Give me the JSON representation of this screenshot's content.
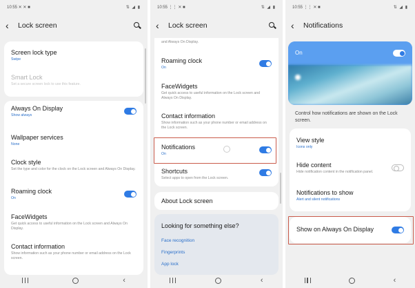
{
  "screen1": {
    "status_time": "10:55 ✕ ✕ ■",
    "status_icons": "⇅ ◢ ▮",
    "title": "Lock screen",
    "rows": {
      "screen_lock_type": {
        "label": "Screen lock type",
        "sub": "Swipe"
      },
      "smart_lock": {
        "label": "Smart Lock",
        "desc": "Set a secure screen lock to use this feature."
      },
      "always_on_display": {
        "label": "Always On Display",
        "sub": "Show always"
      },
      "wallpaper_services": {
        "label": "Wallpaper services",
        "sub": "None"
      },
      "clock_style": {
        "label": "Clock style",
        "desc": "Set the type and color for the clock on the Lock screen and Always On Display."
      },
      "roaming_clock": {
        "label": "Roaming clock",
        "sub": "On"
      },
      "facewidgets": {
        "label": "FaceWidgets",
        "desc": "Get quick access to useful information on the Lock screen and Always On Display."
      },
      "contact_information": {
        "label": "Contact information",
        "desc": "Show information such as your phone number or email address on the Lock screen."
      }
    }
  },
  "screen2": {
    "status_time": "10:55 ⋮⋮ ✕ ■",
    "status_icons": "⇅ ◢ ▮",
    "title": "Lock screen",
    "top_cut": "and Always On Display.",
    "rows": {
      "roaming_clock": {
        "label": "Roaming clock",
        "sub": "On"
      },
      "facewidgets": {
        "label": "FaceWidgets",
        "desc": "Get quick access to useful information on the Lock screen and Always On Display."
      },
      "contact_information": {
        "label": "Contact information",
        "desc": "Show information such as your phone number or email address on the Lock screen."
      },
      "notifications": {
        "label": "Notifications",
        "sub": "On"
      },
      "shortcuts": {
        "label": "Shortcuts",
        "desc": "Select apps to open from the Lock screen."
      }
    },
    "about": "About Lock screen",
    "looking": {
      "title": "Looking for something else?",
      "links": [
        "Face recognition",
        "Fingerprints",
        "App lock"
      ]
    }
  },
  "screen3": {
    "status_time": "10:55 ⋮⋮ ✕ ■",
    "status_icons": "⇅ ◢ ▮",
    "title": "Notifications",
    "on_label": "On",
    "control_text": "Control how notifications are shown on the Lock screen.",
    "rows": {
      "view_style": {
        "label": "View style",
        "sub": "Icons only"
      },
      "hide_content": {
        "label": "Hide content",
        "desc": "Hide notification content in the notification panel."
      },
      "notifications_to_show": {
        "label": "Notifications to show",
        "sub": "Alert and silent notifications"
      },
      "show_on_aod": {
        "label": "Show on Always On Display"
      }
    }
  },
  "colors": {
    "accent": "#2f7be4",
    "highlight": "#c95a4a",
    "background": "#f0f0f0"
  },
  "icons": [
    "back-arrow-icon",
    "search-icon",
    "recent-apps-icon",
    "home-icon",
    "nav-back-icon"
  ]
}
